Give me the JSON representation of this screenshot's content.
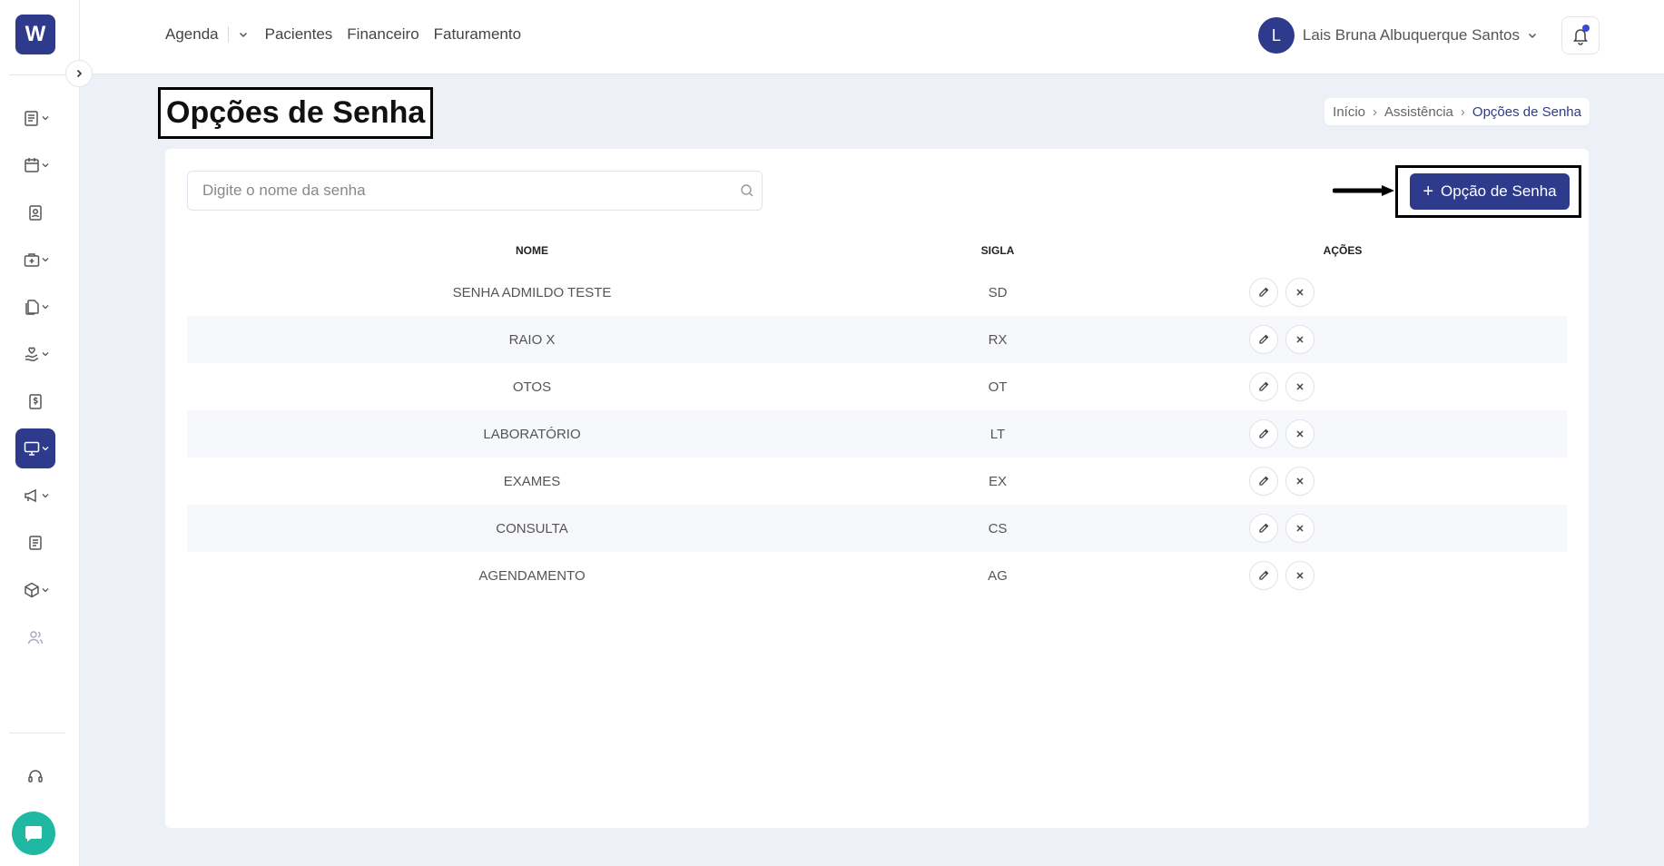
{
  "logo": {
    "letter": "W"
  },
  "nav": {
    "items": [
      "Agenda",
      "Pacientes",
      "Financeiro",
      "Faturamento"
    ]
  },
  "user": {
    "initial": "L",
    "name": "Lais Bruna Albuquerque Santos"
  },
  "page": {
    "title": "Opções de Senha"
  },
  "breadcrumb": {
    "items": [
      "Início",
      "Assistência",
      "Opções de Senha"
    ]
  },
  "search": {
    "placeholder": "Digite o nome da senha",
    "value": ""
  },
  "add_button": {
    "label": "Opção de Senha"
  },
  "table": {
    "headers": {
      "nome": "NOME",
      "sigla": "SIGLA",
      "acoes": "AÇÕES"
    },
    "rows": [
      {
        "nome": "SENHA ADMILDO TESTE",
        "sigla": "SD"
      },
      {
        "nome": "RAIO X",
        "sigla": "RX"
      },
      {
        "nome": "OTOS",
        "sigla": "OT"
      },
      {
        "nome": "LABORATÓRIO",
        "sigla": "LT"
      },
      {
        "nome": "EXAMES",
        "sigla": "EX"
      },
      {
        "nome": "CONSULTA",
        "sigla": "CS"
      },
      {
        "nome": "AGENDAMENTO",
        "sigla": "AG"
      }
    ]
  },
  "colors": {
    "primary": "#2e3a8c",
    "chat": "#1fb8a3",
    "background": "#eef0f8"
  }
}
